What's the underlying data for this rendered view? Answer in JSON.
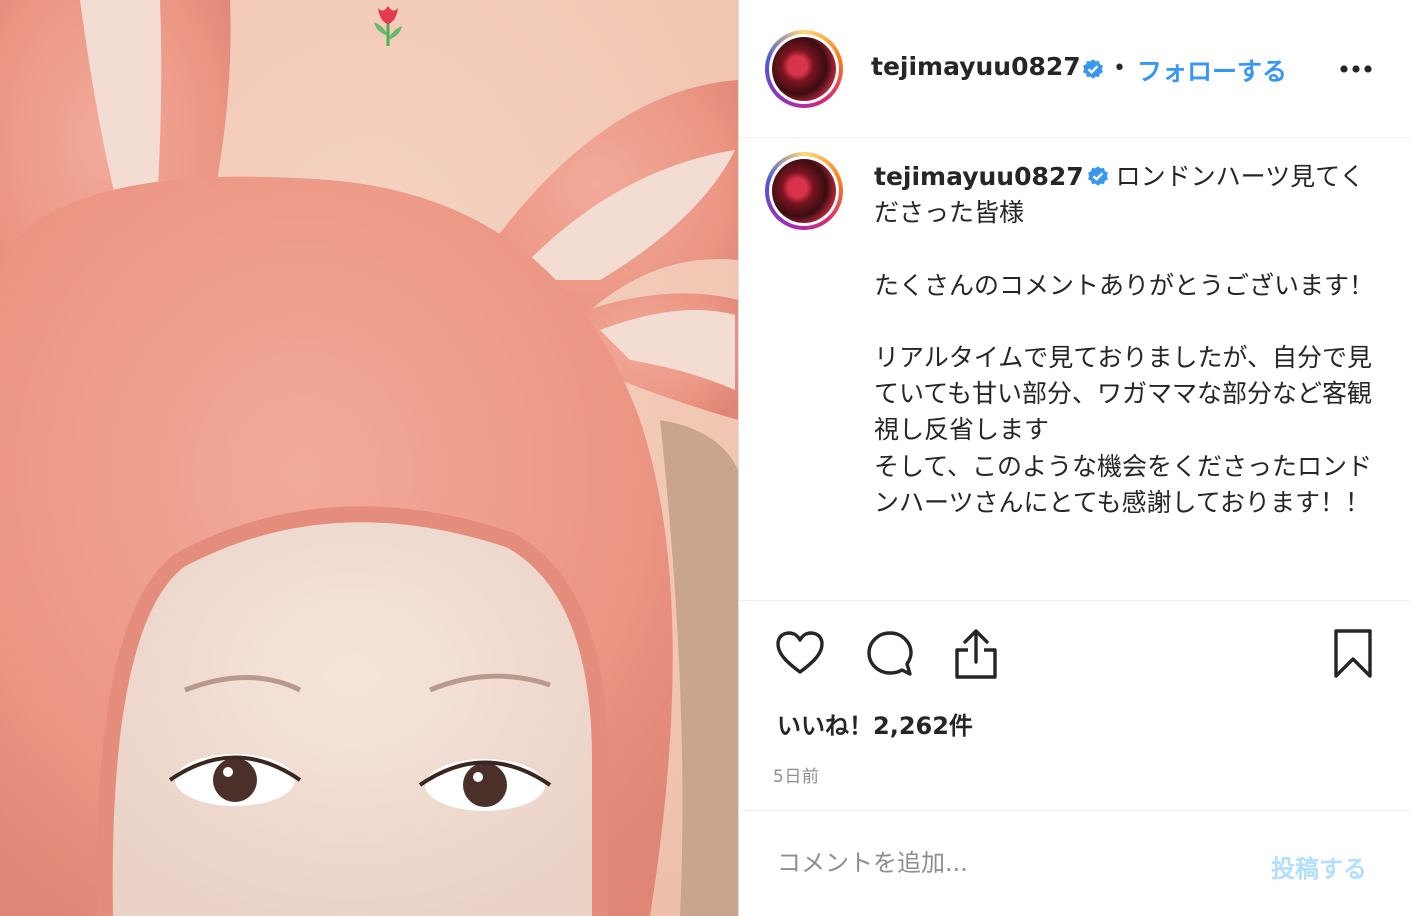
{
  "post": {
    "username": "tejimayuu0827",
    "follow_label": "フォローする",
    "separator": "•",
    "caption": "ロンドンハーツ見てくださった皆様\n\nたくさんのコメントありがとうございます！\n\nリアルタイムで見ておりましたが、自分で見ていても甘い部分、ワガママな部分など客観視し反省します\nそして、このような機会をくださったロンドンハーツさんにとても感謝しております！！",
    "likes_text": "いいね！2,262件",
    "time_text": "5日前"
  },
  "comment": {
    "placeholder": "コメントを追加...",
    "post_label": "投稿する"
  },
  "icons": {
    "verified": "verified-badge-icon",
    "more": "more-options-icon",
    "like": "heart-icon",
    "comment": "comment-bubble-icon",
    "share": "share-icon",
    "save": "bookmark-icon",
    "photo_sticker": "tulip-icon"
  },
  "colors": {
    "link_blue": "#3897f0",
    "verified_blue": "#3897f0",
    "post_disabled": "#b2dffc",
    "photo_bg": "#f3cbb8",
    "hood_pink": "#ef9c8d"
  }
}
